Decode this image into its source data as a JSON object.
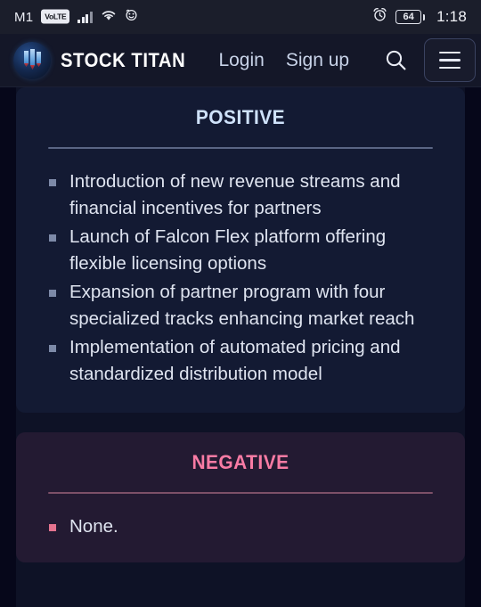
{
  "statusbar": {
    "carrier": "M1",
    "volte": "VoLTE",
    "signal_icon": "signal-bars-icon",
    "wifi_icon": "wifi-icon",
    "face_icon": "face-icon",
    "alarm_icon": "alarm-clock-icon",
    "battery_level": "64",
    "time": "1:18"
  },
  "navbar": {
    "logo_icon": "stock-titan-logo-icon",
    "brand": "STOCK TITAN",
    "links": [
      {
        "label": "Login"
      },
      {
        "label": "Sign up"
      }
    ],
    "search_icon": "search-icon",
    "menu_icon": "hamburger-menu-icon"
  },
  "main": {
    "cards": [
      {
        "title": "Positive",
        "accent": "#cfe2fb",
        "bullets": [
          "Introduction of new revenue streams and financial incentives for partners",
          "Launch of Falcon Flex platform offering flexible licensing options",
          "Expansion of partner program with four specialized tracks enhancing market reach",
          "Implementation of automated pricing and standardized distribution model"
        ]
      },
      {
        "title": "Negative",
        "accent": "#f87ba4",
        "bullets": [
          "None."
        ]
      }
    ]
  }
}
